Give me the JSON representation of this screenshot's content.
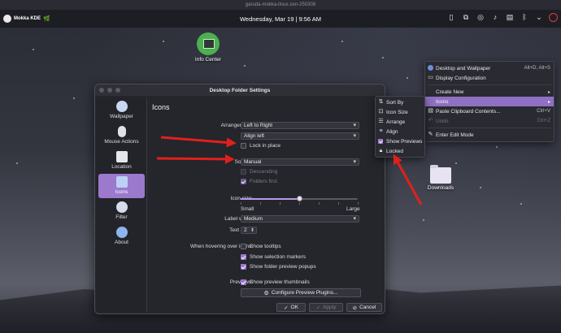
{
  "vm_title": "garuda-mokka-linux-zen-250308",
  "panel": {
    "app_name": "Mokka KDE",
    "clock": "Wednesday, Mar 19 | 9:56 AM"
  },
  "desktop_icons": {
    "info_center": "Info Center",
    "downloads": "Downloads"
  },
  "dialog": {
    "title": "Desktop Folder Settings",
    "heading": "Icons",
    "sidebar": [
      {
        "label": "Wallpaper",
        "icon": "wallpaper-icon"
      },
      {
        "label": "Mouse Actions",
        "icon": "mouse-icon"
      },
      {
        "label": "Location",
        "icon": "folder-icon"
      },
      {
        "label": "Icons",
        "icon": "icons-icon"
      },
      {
        "label": "Filter",
        "icon": "filter-icon"
      },
      {
        "label": "About",
        "icon": "info-icon"
      }
    ],
    "arrangement_label": "Arrangement:",
    "arrangement_value": "Left to Right",
    "align_value": "Align left",
    "lock_label": "Lock in place",
    "sorting_label": "Sorting:",
    "sorting_value": "Manual",
    "descending_label": "Descending",
    "folders_first_label": "Folders first",
    "icon_size_label": "Icon size:",
    "icon_size_level": 0.5,
    "size_small": "Small",
    "size_large": "Large",
    "label_width_label": "Label width:",
    "label_width_value": "Medium",
    "text_lines_label": "Text lines:",
    "text_lines_value": "2",
    "hover_label": "When hovering over icons:",
    "show_tooltips": "Show tooltips",
    "show_selection_markers": "Show selection markers",
    "show_folder_preview": "Show folder preview popups",
    "previews_label": "Previews:",
    "show_preview_thumbnails": "Show preview thumbnails",
    "configure_plugins": "Configure Preview Plugins...",
    "ok": "OK",
    "apply": "Apply",
    "cancel": "Cancel"
  },
  "context_menu": {
    "items": [
      {
        "label": "Desktop and Wallpaper",
        "shortcut": "Alt+D, Alt+S"
      },
      {
        "label": "Display Configuration",
        "shortcut": ""
      },
      {
        "label": "Create New",
        "shortcut": ""
      },
      {
        "label": "Icons",
        "shortcut": ""
      },
      {
        "label": "Paste Clipboard Contents...",
        "shortcut": "Ctrl+V"
      },
      {
        "label": "Undo",
        "shortcut": "Ctrl+Z"
      },
      {
        "label": "Enter Edit Mode",
        "shortcut": ""
      }
    ]
  },
  "icons_submenu": {
    "items": [
      {
        "label": "Sort By"
      },
      {
        "label": "Icon Size"
      },
      {
        "label": "Arrange"
      },
      {
        "label": "Align"
      },
      {
        "label": "Show Previews"
      },
      {
        "label": "Locked"
      }
    ]
  },
  "colors": {
    "accent": "#9b79cc",
    "arrow": "#e0201c"
  }
}
